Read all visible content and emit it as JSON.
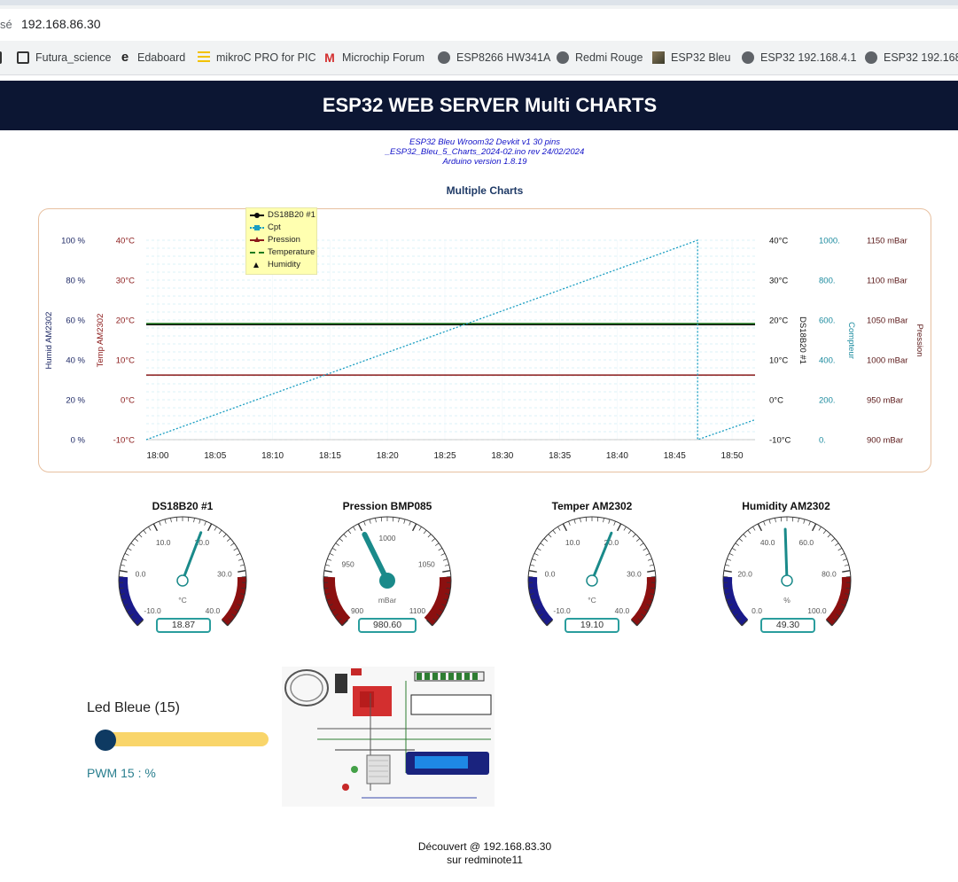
{
  "browser": {
    "address_prefix": "sé",
    "url": "192.168.86.30",
    "bookmarks": [
      {
        "label": "Futura_science",
        "icon": "futura-icon"
      },
      {
        "label": "Edaboard",
        "icon": "edaboard-icon"
      },
      {
        "label": "mikroC PRO for PIC",
        "icon": "mikroc-icon"
      },
      {
        "label": "Microchip Forum",
        "icon": "microchip-icon"
      },
      {
        "label": "ESP8266 HW341A",
        "icon": "globe-icon"
      },
      {
        "label": "Redmi Rouge",
        "icon": "globe-icon"
      },
      {
        "label": "ESP32  Bleu",
        "icon": "thumbnail-icon"
      },
      {
        "label": "ESP32  192.168.4.1",
        "icon": "globe-icon"
      },
      {
        "label": "ESP32  192.168.4",
        "icon": "globe-icon"
      }
    ]
  },
  "header": {
    "title": "ESP32 WEB SERVER Multi CHARTS"
  },
  "info": {
    "line1": "ESP32 Bleu Wroom32 Devkit v1 30 pins",
    "line2": "_ESP32_Bleu_5_Charts_2024-02.ino rev 24/02/2024",
    "line3": "Arduino version 1.8.19"
  },
  "chart_heading": "Multiple Charts",
  "chart_data": {
    "type": "line",
    "x_ticks": [
      "18:00",
      "18:05",
      "18:10",
      "18:15",
      "18:20",
      "18:25",
      "18:30",
      "18:35",
      "18:40",
      "18:45",
      "18:50"
    ],
    "xlim": [
      "17:59",
      "18:52"
    ],
    "legend": [
      "DS18B20 #1",
      "Cpt",
      "Pression",
      "Temperature",
      "Humidity"
    ],
    "legend_placement": "top-left",
    "axes": {
      "humid": {
        "label": "Humid AM2302",
        "ticks": [
          "0 %",
          "20 %",
          "40 %",
          "60 %",
          "80 %",
          "100 %"
        ],
        "range": [
          0,
          100
        ]
      },
      "temp": {
        "label": "Temp AM2302",
        "ticks": [
          "-10°C",
          "0°C",
          "10°C",
          "20°C",
          "30°C",
          "40°C"
        ],
        "range": [
          -10,
          40
        ]
      },
      "ds18": {
        "label": "DS18B20 #1",
        "ticks": [
          "-10°C",
          "0°C",
          "10°C",
          "20°C",
          "30°C",
          "40°C"
        ],
        "range": [
          -10,
          40
        ]
      },
      "cpt": {
        "label": "Compteur",
        "ticks": [
          "0.",
          "200.",
          "400.",
          "600.",
          "800.",
          "1000."
        ],
        "range": [
          0,
          1000
        ]
      },
      "pression": {
        "label": "Pression",
        "ticks": [
          "900 mBar",
          "950 mBar",
          "1000 mBar",
          "1050 mBar",
          "1100 mBar",
          "1150 mBar"
        ],
        "range": [
          900,
          1150
        ]
      }
    },
    "series": [
      {
        "name": "DS18B20 #1",
        "axis": "ds18",
        "color": "#0a0a0a",
        "x": [
          "17:59",
          "18:52"
        ],
        "values": [
          18.9,
          18.9
        ]
      },
      {
        "name": "Temperature",
        "axis": "temp",
        "color": "#1f7a1f",
        "x": [
          "17:59",
          "18:52"
        ],
        "values": [
          19.1,
          19.1
        ]
      },
      {
        "name": "Pression",
        "axis": "pression",
        "color": "#8b1a1a",
        "x": [
          "17:59",
          "18:52"
        ],
        "values": [
          981,
          981
        ]
      },
      {
        "name": "Cpt",
        "axis": "cpt",
        "color": "#1a9ec2",
        "x": [
          "17:59",
          "18:47",
          "18:47",
          "18:52"
        ],
        "values": [
          0,
          1000,
          0,
          100
        ]
      }
    ],
    "grid": true
  },
  "gauges": [
    {
      "title": "DS18B20 #1",
      "value": "18.87",
      "unit": "°C",
      "ticks": [
        "-10.0",
        "0.0",
        "10.0",
        "20.0",
        "30.0",
        "40.0"
      ],
      "min": -10,
      "max": 40,
      "level": 18.87,
      "style": "thin"
    },
    {
      "title": "Pression BMP085",
      "value": "980.60",
      "unit": "mBar",
      "ticks": [
        "900",
        "950",
        "1000",
        "1050",
        "1100"
      ],
      "min": 900,
      "max": 1100,
      "level": 980.6,
      "style": "thick"
    },
    {
      "title": "Temper AM2302",
      "value": "19.10",
      "unit": "°C",
      "ticks": [
        "-10.0",
        "0.0",
        "10.0",
        "20.0",
        "30.0",
        "40.0"
      ],
      "min": -10,
      "max": 40,
      "level": 19.1,
      "style": "thin"
    },
    {
      "title": "Humidity AM2302",
      "value": "49.30",
      "unit": "%",
      "ticks": [
        "0.0",
        "20.0",
        "40.0",
        "60.0",
        "80.0",
        "100.0"
      ],
      "min": 0,
      "max": 100,
      "level": 49.3,
      "style": "thin"
    }
  ],
  "led": {
    "label": "Led Bleue (15)",
    "pwm_label": "PWM 15 : %",
    "slider_value": 0
  },
  "schematic": {
    "alt": "_ESP32_Charts_Cpt_DS18B20_BMP085_AM2302_MCP23017_OLED_2024-11-17"
  },
  "footer": {
    "line1": "Découvert @ 192.168.83.30",
    "line2": "sur redminote11"
  },
  "colors": {
    "header_bg": "#0c1633",
    "cpt": "#1a9ec2",
    "pression": "#8b1a1a",
    "temp": "#1f7a1f",
    "ds18": "#0a0a0a",
    "gauge_needle": "#1a8a8a"
  }
}
